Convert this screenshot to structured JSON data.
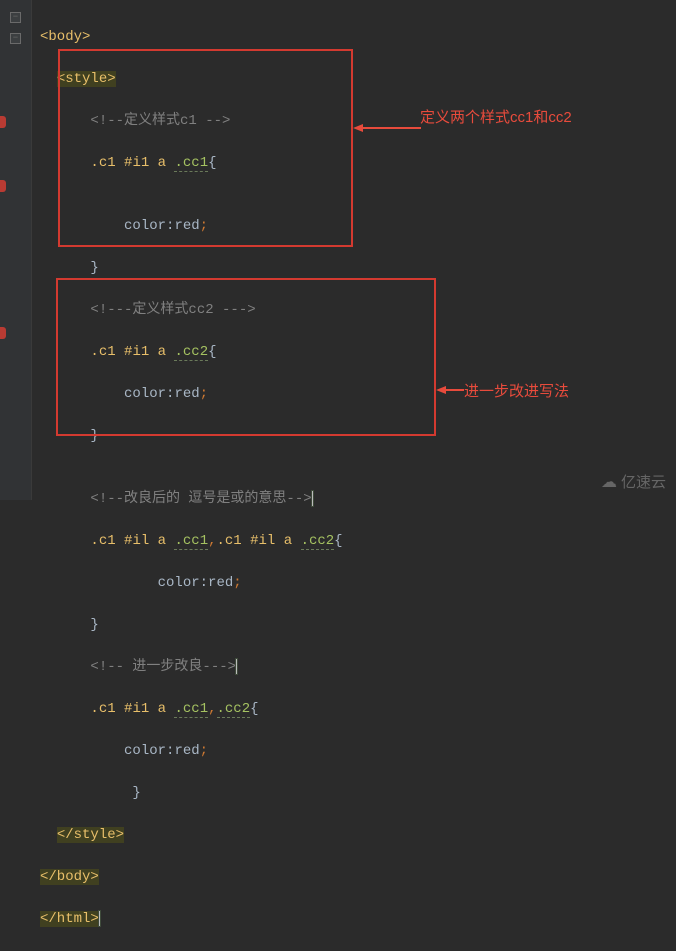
{
  "gutter": {
    "folds": [
      12,
      33
    ]
  },
  "code": {
    "l1": {
      "tag_open": "<body>"
    },
    "l2": {
      "indent": "  ",
      "tag_open": "<style>"
    },
    "l3": {
      "indent": "      ",
      "comment": "<!--定义样式c1 -->"
    },
    "l4": {
      "indent": "      ",
      "cls": ".c1",
      "sp1": " ",
      "id": "#i1",
      "sp2": " ",
      "el": "a",
      "sp3": " ",
      "sub": ".cc1",
      "brace": "{"
    },
    "l5": {
      "indent": ""
    },
    "l6": {
      "indent": "          ",
      "prop": "color",
      "colon": ":",
      "val": "red",
      "semi": ";"
    },
    "l7": {
      "indent": "      ",
      "brace": "}"
    },
    "l8": {
      "indent": "      ",
      "comment": "<!---定义样式cc2 --->"
    },
    "l9": {
      "indent": "      ",
      "cls": ".c1",
      "sp1": " ",
      "id": "#i1",
      "sp2": " ",
      "el": "a",
      "sp3": " ",
      "sub": ".cc2",
      "brace": "{"
    },
    "l10": {
      "indent": "          ",
      "prop": "color",
      "colon": ":",
      "val": "red",
      "semi": ";"
    },
    "l11": {
      "indent": "      ",
      "brace": "}"
    },
    "l12": {
      "indent": ""
    },
    "l13": {
      "indent": "      ",
      "comment": "<!--改良后的 逗号是或的意思-->"
    },
    "l14": {
      "indent": "      ",
      "cls1": ".c1",
      "sp1": " ",
      "id1": "#il",
      "sp2": " ",
      "el1": "a",
      "sp3": " ",
      "sub1": ".cc1",
      "comma": ",",
      "cls2": ".c1",
      "sp4": " ",
      "id2": "#il",
      "sp5": " ",
      "el2": "a",
      "sp6": " ",
      "sub2": ".cc2",
      "brace": "{"
    },
    "l15": {
      "indent": "              ",
      "prop": "color",
      "colon": ":",
      "val": "red",
      "semi": ";"
    },
    "l16": {
      "indent": "      ",
      "brace": "}"
    },
    "l17": {
      "indent": "      ",
      "comment": "<!-- 进一步改良--->"
    },
    "l18": {
      "indent": "      ",
      "cls": ".c1",
      "sp1": " ",
      "id": "#i1",
      "sp2": " ",
      "el": "a",
      "sp3": " ",
      "sub1": ".cc1",
      "comma": ",",
      "sub2": ".cc2",
      "brace": "{"
    },
    "l19": {
      "indent": "          ",
      "prop": "color",
      "colon": ":",
      "val": "red",
      "semi": ";"
    },
    "l20": {
      "indent": "           ",
      "brace": "}"
    },
    "l21": {
      "indent": "  ",
      "tag_close": "</style>"
    },
    "l22": {
      "tag_close": "</body>"
    },
    "l23": {
      "tag_close": "</html>"
    }
  },
  "annotations": {
    "a1": "定义两个样式cc1和cc2",
    "a2": "进一步改进写法"
  },
  "watermark": {
    "text": "亿速云",
    "icon": "☁"
  }
}
